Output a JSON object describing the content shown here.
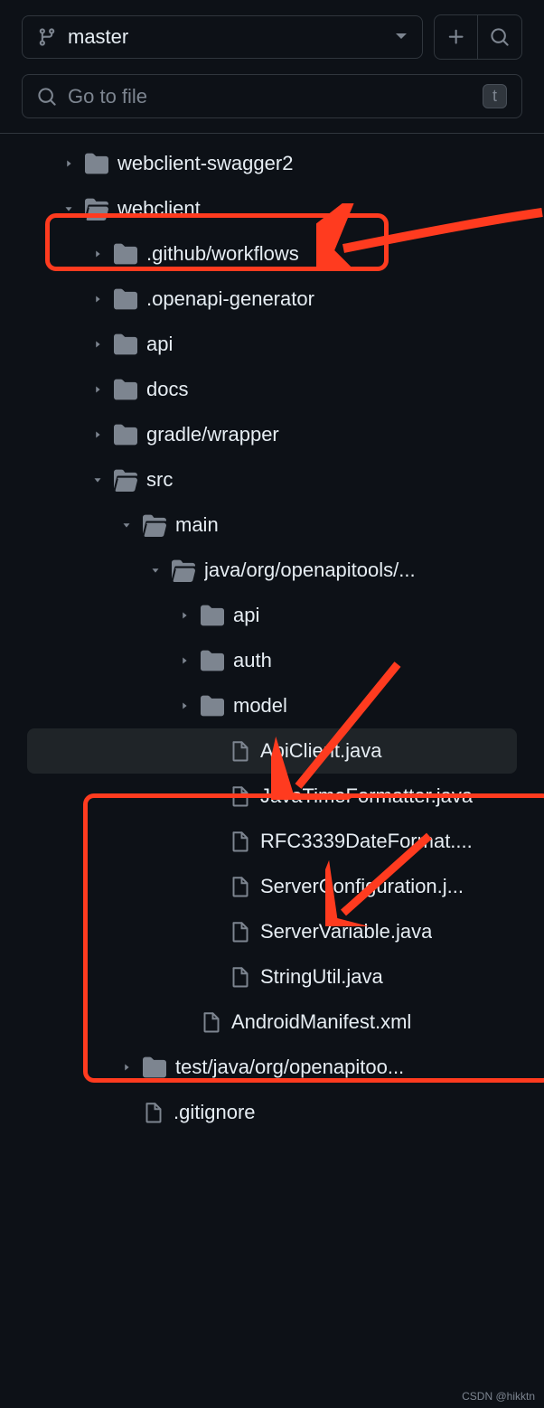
{
  "branch": {
    "name": "master"
  },
  "search": {
    "placeholder": "Go to file",
    "hint": "t"
  },
  "tree": {
    "items": [
      {
        "indent": 84,
        "chevron": "right",
        "icon": "folder",
        "label": "webclient-swagger2"
      },
      {
        "indent": 84,
        "chevron": "down",
        "icon": "folder-open",
        "label": "webclient"
      },
      {
        "indent": 116,
        "chevron": "right",
        "icon": "folder",
        "label": ".github/workflows"
      },
      {
        "indent": 116,
        "chevron": "right",
        "icon": "folder",
        "label": ".openapi-generator"
      },
      {
        "indent": 116,
        "chevron": "right",
        "icon": "folder",
        "label": "api"
      },
      {
        "indent": 116,
        "chevron": "right",
        "icon": "folder",
        "label": "docs"
      },
      {
        "indent": 116,
        "chevron": "right",
        "icon": "folder",
        "label": "gradle/wrapper"
      },
      {
        "indent": 116,
        "chevron": "down",
        "icon": "folder-open",
        "label": "src"
      },
      {
        "indent": 148,
        "chevron": "down",
        "icon": "folder-open",
        "label": "main"
      },
      {
        "indent": 180,
        "chevron": "down",
        "icon": "folder-open",
        "label": "java/org/openapitools/..."
      },
      {
        "indent": 212,
        "chevron": "right",
        "icon": "folder",
        "label": "api"
      },
      {
        "indent": 212,
        "chevron": "right",
        "icon": "folder",
        "label": "auth"
      },
      {
        "indent": 212,
        "chevron": "right",
        "icon": "folder",
        "label": "model"
      },
      {
        "indent": 244,
        "chevron": "none",
        "icon": "file",
        "label": "ApiClient.java",
        "selected": true
      },
      {
        "indent": 244,
        "chevron": "none",
        "icon": "file",
        "label": "JavaTimeFormatter.java"
      },
      {
        "indent": 244,
        "chevron": "none",
        "icon": "file",
        "label": "RFC3339DateFormat...."
      },
      {
        "indent": 244,
        "chevron": "none",
        "icon": "file",
        "label": "ServerConfiguration.j..."
      },
      {
        "indent": 244,
        "chevron": "none",
        "icon": "file",
        "label": "ServerVariable.java"
      },
      {
        "indent": 244,
        "chevron": "none",
        "icon": "file",
        "label": "StringUtil.java"
      },
      {
        "indent": 212,
        "chevron": "none",
        "icon": "file",
        "label": "AndroidManifest.xml"
      },
      {
        "indent": 148,
        "chevron": "right",
        "icon": "folder",
        "label": "test/java/org/openapitoo..."
      },
      {
        "indent": 148,
        "chevron": "none",
        "icon": "file",
        "label": ".gitignore"
      }
    ]
  },
  "watermark": "CSDN @hikktn"
}
